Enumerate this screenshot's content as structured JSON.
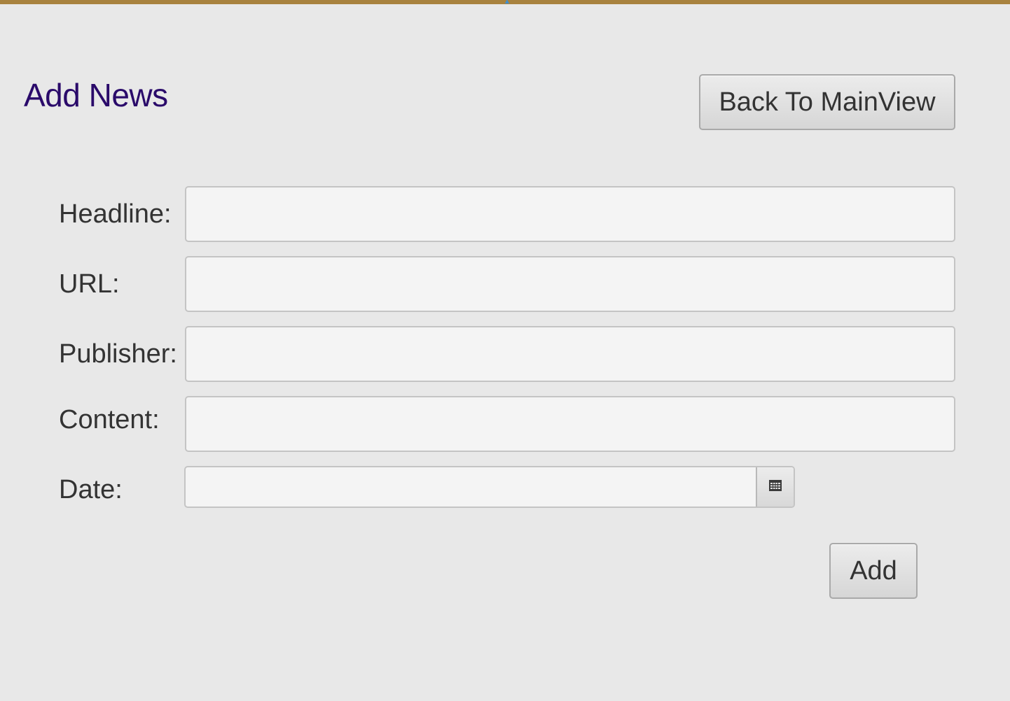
{
  "page": {
    "title": "Add News",
    "back_button_label": "Back To MainView",
    "add_button_label": "Add"
  },
  "form": {
    "headline": {
      "label": "Headline:",
      "value": ""
    },
    "url": {
      "label": "URL:",
      "value": ""
    },
    "publisher": {
      "label": "Publisher:",
      "value": ""
    },
    "content": {
      "label": "Content:",
      "value": ""
    },
    "date": {
      "label": "Date:",
      "value": ""
    }
  },
  "icons": {
    "date_picker": "calendar-icon"
  },
  "colors": {
    "top_border": "#a8823e",
    "title": "#2a0a6a",
    "background": "#e8e8e8",
    "text": "#333333"
  }
}
